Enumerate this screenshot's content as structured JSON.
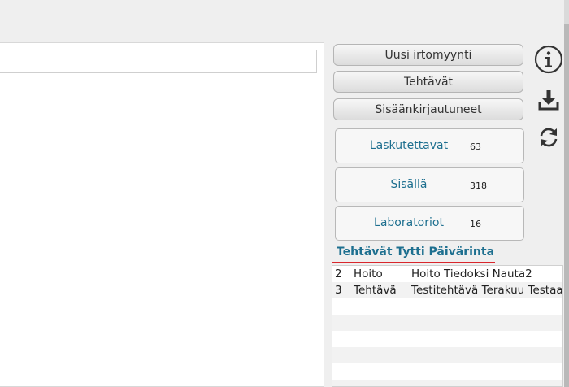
{
  "sidebar": {
    "buttons": [
      {
        "label": "Uusi irtomyynti"
      },
      {
        "label": "Tehtävät"
      },
      {
        "label": "Sisäänkirjautuneet"
      }
    ],
    "stats": [
      {
        "label": "Laskutettavat",
        "count": "63"
      },
      {
        "label": "Sisällä",
        "count": "318"
      },
      {
        "label": "Laboratoriot",
        "count": "16"
      }
    ],
    "icons": [
      "info-icon",
      "download-icon",
      "refresh-icon"
    ]
  },
  "tasks": {
    "title": "Tehtävät Tytti Päivärinta",
    "rows": [
      {
        "num": "2",
        "type": "Hoito",
        "desc": "Hoito Tiedoksi  Nauta2"
      },
      {
        "num": "3",
        "type": "Tehtävä",
        "desc": "Testitehtävä Terakuu Testaa"
      },
      {
        "num": "",
        "type": "",
        "desc": ""
      },
      {
        "num": "",
        "type": "",
        "desc": ""
      },
      {
        "num": "",
        "type": "",
        "desc": ""
      },
      {
        "num": "",
        "type": "",
        "desc": ""
      },
      {
        "num": "",
        "type": "",
        "desc": ""
      },
      {
        "num": "",
        "type": "",
        "desc": ""
      }
    ]
  },
  "colors": {
    "accent": "#1d6f8f",
    "underline": "#d9262c"
  }
}
